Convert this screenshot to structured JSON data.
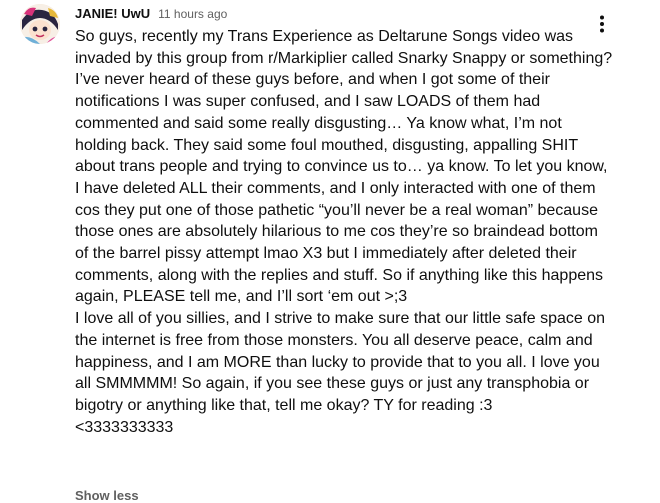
{
  "comment": {
    "author": "JANIE! UwU",
    "timestamp": "11 hours ago",
    "body": "So guys, recently my Trans Experience as Deltarune Songs video was invaded by this group from r/Markiplier called Snarky Snappy or something? I’ve never heard of these guys before, and when I got some of their notifications I was super confused, and I saw LOADS of them had commented and said some really disgusting… Ya know what, I’m not holding back. They said some foul mouthed, disgusting, appalling SHIT about trans people and trying to convince us to… ya know. To let you know, I have deleted ALL their comments, and I only interacted with one of them cos they put one of those pathetic “you’ll never be a real woman” because those ones are absolutely hilarious to me cos they’re so braindead bottom of the barrel pissy attempt lmao X3 but I immediately after deleted their comments, along with the replies and stuff. So if anything like this happens again, PLEASE tell me, and I’ll sort ‘em out >;3\nI love all of you sillies, and I strive to make sure that our little safe space on the internet is free from those monsters. You all deserve peace, calm and happiness, and I am MORE than lucky to provide that to you all. I love you all SMMMMM! So again, if you see these guys or just any transphobia or bigotry or anything like that, tell me okay? TY for reading :3\n<3333333333",
    "show_less_label": "Show less",
    "avatar_icon": "avatar-image",
    "menu_icon": "more-vertical-icon"
  },
  "colors": {
    "text_primary": "#0f0f0f",
    "text_secondary": "#606060",
    "background": "#ffffff"
  }
}
